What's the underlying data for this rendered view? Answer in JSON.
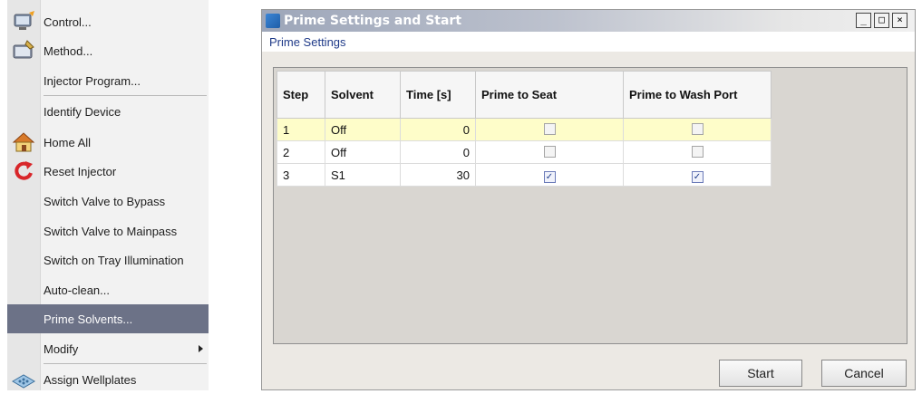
{
  "menu": {
    "items": [
      {
        "label": "Control...",
        "icon": "monitor-icon"
      },
      {
        "label": "Method...",
        "icon": "method-edit-icon"
      },
      {
        "label": "Injector Program...",
        "icon": ""
      },
      {
        "label": "Identify Device",
        "icon": ""
      },
      {
        "label": "Home All",
        "icon": "home-icon"
      },
      {
        "label": "Reset Injector",
        "icon": "reset-icon"
      },
      {
        "label": "Switch Valve to Bypass",
        "icon": ""
      },
      {
        "label": "Switch Valve to Mainpass",
        "icon": ""
      },
      {
        "label": "Switch on Tray Illumination",
        "icon": ""
      },
      {
        "label": "Auto-clean...",
        "icon": ""
      },
      {
        "label": "Prime Solvents...",
        "icon": "",
        "highlighted": true
      },
      {
        "label": "Modify",
        "icon": "",
        "submenu": true
      },
      {
        "label": "Assign Wellplates",
        "icon": "wellplate-icon"
      }
    ],
    "highlight_color": "#6c7287"
  },
  "dialog": {
    "title": "Prime Settings and Start",
    "window_buttons": {
      "minimize": "_",
      "maximize": "□",
      "close": "×"
    },
    "subtitle": "Prime Settings",
    "table": {
      "headers": [
        "Step",
        "Solvent",
        "Time [s]",
        "Prime to Seat",
        "Prime to Wash Port"
      ],
      "rows": [
        {
          "step": "1",
          "solvent": "Off",
          "time": "0",
          "seat": false,
          "wash": false,
          "selected": true
        },
        {
          "step": "2",
          "solvent": "Off",
          "time": "0",
          "seat": false,
          "wash": false
        },
        {
          "step": "3",
          "solvent": "S1",
          "time": "30",
          "seat": true,
          "wash": true
        }
      ]
    },
    "buttons": {
      "start": "Start",
      "cancel": "Cancel"
    }
  }
}
